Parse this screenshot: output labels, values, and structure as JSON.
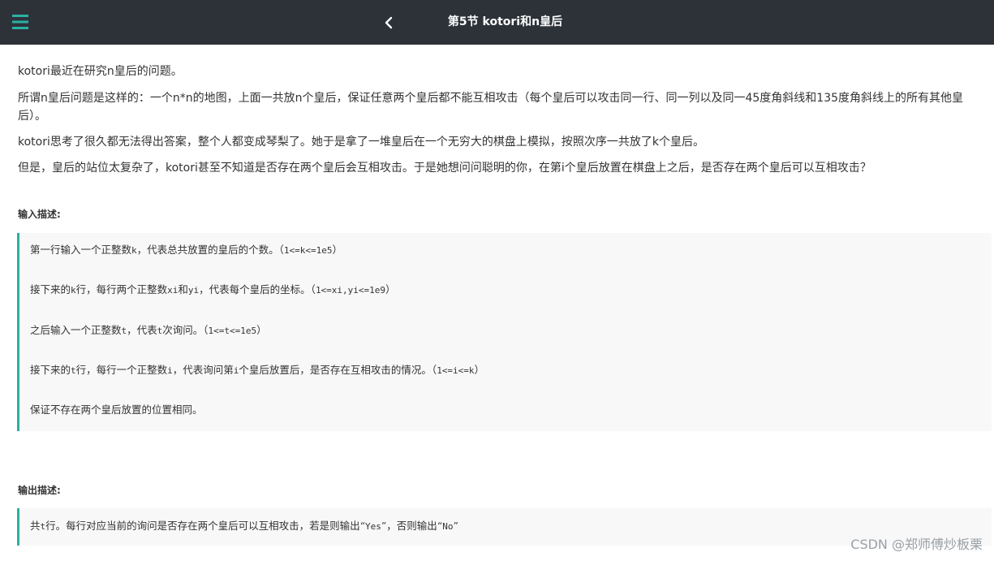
{
  "header": {
    "title": "第5节 kotori和n皇后"
  },
  "problem": {
    "paragraphs": [
      "kotori最近在研究n皇后的问题。",
      "所谓n皇后问题是这样的：一个n*n的地图，上面一共放n个皇后，保证任意两个皇后都不能互相攻击（每个皇后可以攻击同一行、同一列以及同一45度角斜线和135度角斜线上的所有其他皇后）。",
      "kotori思考了很久都无法得出答案，整个人都变成琴梨了。她于是拿了一堆皇后在一个无穷大的棋盘上模拟，按照次序一共放了k个皇后。",
      "但是，皇后的站位太复杂了，kotori甚至不知道是否存在两个皇后会互相攻击。于是她想问问聪明的你，在第i个皇后放置在棋盘上之后，是否存在两个皇后可以互相攻击？"
    ]
  },
  "input_section": {
    "title": "输入描述:",
    "lines": [
      {
        "a": "第一行输入一个正整数",
        "b": "k",
        "c": "，代表总共放置的皇后的个数。（",
        "d": "1<=k<=1e5",
        "e": "）"
      },
      {
        "a": "接下来的",
        "b": "k",
        "c": "行，每行两个正整数",
        "d": "xi",
        "e": "和",
        "f": "yi",
        "g": "，代表每个皇后的坐标。（",
        "h": "1<=xi,yi<=1e9",
        "i": "）"
      },
      {
        "a": "之后输入一个正整数",
        "b": "t",
        "c": "，代表",
        "d": "t",
        "e": "次询问。（",
        "f": "1<=t<=1e5",
        "g": "）"
      },
      {
        "a": "接下来的",
        "b": "t",
        "c": "行，每行一个正整数",
        "d": "i",
        "e": "，代表询问第",
        "f": "i",
        "g": "个皇后放置后，是否存在互相攻击的情况。（",
        "h": "1<=i<=k",
        "i": "）"
      },
      {
        "a": "保证不存在两个皇后放置的位置相同。"
      }
    ]
  },
  "output_section": {
    "title": "输出描述:",
    "line": {
      "a": "共",
      "b": "t",
      "c": "行。每行对应当前的询问是否存在两个皇后可以互相攻击，若是则输出“",
      "d": "Yes",
      "e": "”，否则输出“",
      "f": "No",
      "g": "”"
    }
  },
  "watermark": "CSDN @郑师傅炒板栗"
}
